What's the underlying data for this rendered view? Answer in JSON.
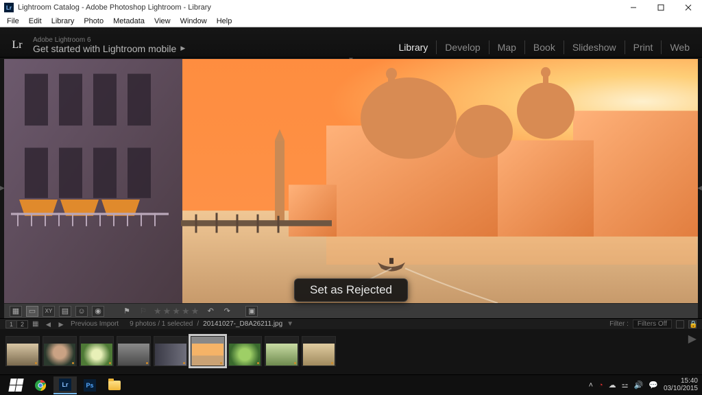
{
  "window": {
    "title": "Lightroom Catalog - Adobe Photoshop Lightroom - Library"
  },
  "menubar": [
    "File",
    "Edit",
    "Library",
    "Photo",
    "Metadata",
    "View",
    "Window",
    "Help"
  ],
  "identity": {
    "brand": "Adobe Lightroom 6",
    "promo": "Get started with Lightroom mobile"
  },
  "modules": [
    "Library",
    "Develop",
    "Map",
    "Book",
    "Slideshow",
    "Print",
    "Web"
  ],
  "toast": "Set as Rejected",
  "filmhdr": {
    "mon1": "1",
    "mon2": "2",
    "source": "Previous Import",
    "count": "9 photos / 1 selected",
    "sep": "/",
    "filename": "20141027-_D8A26211.jpg",
    "filter_label": "Filter :",
    "filter_value": "Filters Off"
  },
  "clock": {
    "time": "15:40",
    "date": "03/10/2015"
  }
}
